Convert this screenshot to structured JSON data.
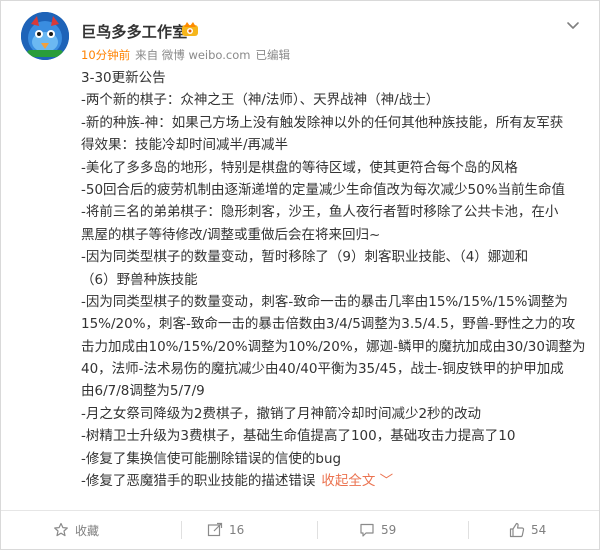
{
  "post": {
    "author": "巨鸟多多工作室",
    "time": "10分钟前",
    "source": "来自 微博 weibo.com",
    "edited": "已编辑",
    "lines": [
      "3-30更新公告",
      "-两个新的棋子：众神之王（神/法师）、天界战神（神/战士）",
      "-新的种族-神：如果己方场上没有触发除神以外的任何其他种族技能，所有友军获",
      "得效果：技能冷却时间减半/再减半",
      "-美化了多多岛的地形，特别是棋盘的等待区域，使其更符合每个岛的风格",
      "-50回合后的疲劳机制由逐渐递增的定量减少生命值改为每次减少50%当前生命值",
      "-将前三名的弟弟棋子：隐形刺客，沙王，鱼人夜行者暂时移除了公共卡池，在小",
      "黑屋的棋子等待修改/调整或重做后会在将来回归~",
      "-因为同类型棋子的数量变动，暂时移除了（9）刺客职业技能、（4）娜迦和",
      "（6）野兽种族技能",
      "-因为同类型棋子的数量变动，刺客-致命一击的暴击几率由15%/15%/15%调整为",
      "15%/20%，刺客-致命一击的暴击倍数由3/4/5调整为3.5/4.5，野兽-野性之力的攻",
      "击力加成由10%/15%/20%调整为10%/20%，娜迦-鳞甲的魔抗加成由30/30调整为",
      "40，法师-法术易伤的魔抗减少由40/40平衡为35/45，战士-铜皮铁甲的护甲加成",
      "由6/7/8调整为5/7/9",
      "-月之女祭司降级为2费棋子，撤销了月神箭冷却时间减少2秒的改动",
      "-树精卫士升级为3费棋子，基础生命值提高了100，基础攻击力提高了10",
      "-修复了集换信使可能删除错误的信使的bug",
      "-修复了恶魔猎手的职业技能的描述错误"
    ],
    "collapse_label": "收起全文",
    "collapse_arrow": "﹀"
  },
  "actions": {
    "favorite_label": "收藏",
    "forward_count": "16",
    "comment_count": "59",
    "like_count": "54"
  },
  "icons": {
    "more": "chevron-down-icon",
    "vip": "vip-badge-icon",
    "favorite": "star-icon",
    "forward": "forward-icon",
    "comment": "comment-icon",
    "like": "thumb-up-icon"
  },
  "colors": {
    "time": "#ff8200",
    "collapse": "#eb7350",
    "meta": "#8a8a8a",
    "text": "#333333"
  }
}
